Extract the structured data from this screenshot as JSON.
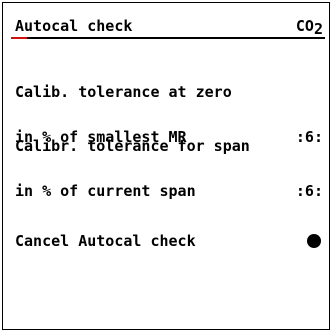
{
  "header": {
    "title": "Autocal check",
    "gas_main": "CO",
    "gas_sub": "2"
  },
  "params": [
    {
      "line1": "Calib. tolerance at zero",
      "line2": "in % of smallest MR",
      "value": ":6:"
    },
    {
      "line1": "Calibr. tolerance for span",
      "line2": "in % of current span",
      "value": ":6:"
    }
  ],
  "action": {
    "label": "Cancel Autocal check"
  },
  "colors": {
    "accent": "#cc1111",
    "text": "#000000",
    "background": "#ffffff"
  }
}
